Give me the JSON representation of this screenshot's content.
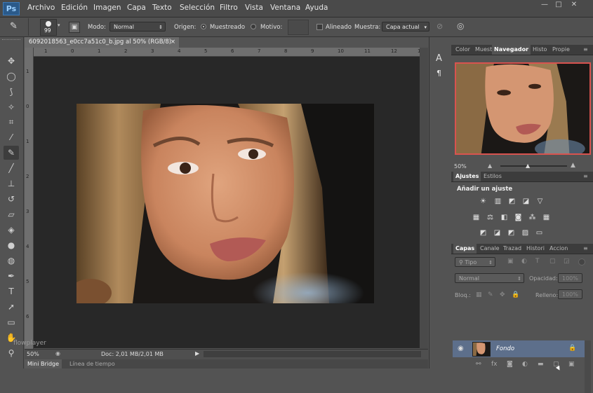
{
  "app": {
    "logo": "Ps"
  },
  "menu": [
    "Archivo",
    "Edición",
    "Imagen",
    "Capa",
    "Texto",
    "Selección",
    "Filtro",
    "Vista",
    "Ventana",
    "Ayuda"
  ],
  "window_controls": [
    "—",
    "□",
    "✕"
  ],
  "options": {
    "brush_size": "99",
    "modo_label": "Modo:",
    "modo_value": "Normal",
    "origen_label": "Origen:",
    "muestreado_label": "Muestreado",
    "motivo_label": "Motivo:",
    "alineado_label": "Alineado",
    "muestra_label": "Muestra:",
    "muestra_value": "Capa actual"
  },
  "document": {
    "tab_title": "6092018563_e0cc7a51c0_b.jpg al 50% (RGB/8)",
    "tab_close": "×",
    "ruler_h": [
      "1",
      "0",
      "1",
      "2",
      "3",
      "4",
      "5",
      "6",
      "7",
      "8",
      "9",
      "10",
      "11",
      "12",
      "13",
      "14"
    ],
    "ruler_v": [
      "1",
      "0",
      "1",
      "2",
      "3",
      "4",
      "5",
      "6"
    ],
    "zoom": "50%",
    "doc_info": "Doc: 2,01 MB/2,01 MB",
    "watermark": "flowplayer"
  },
  "bottom_tabs": [
    "Mini Bridge",
    "Línea de tiempo"
  ],
  "navigator": {
    "tabs": [
      "Color",
      "Muest",
      "Navegador",
      "Histo",
      "Propie"
    ],
    "zoom": "50%"
  },
  "adjustments": {
    "tabs": [
      "Ajustes",
      "Estilos"
    ],
    "title": "Añadir un ajuste"
  },
  "layers": {
    "tabs": [
      "Capas",
      "Canale",
      "Trazad",
      "Histori",
      "Accion"
    ],
    "filter": "Tipo",
    "blend_mode": "Normal",
    "opacity_label": "Opacidad:",
    "opacity_value": "100%",
    "lock_label": "Bloq.:",
    "fill_label": "Relleno:",
    "fill_value": "100%",
    "layer_name": "Fondo"
  },
  "colors": {
    "accent_red": "#d9534f",
    "layer_selected": "#5d6f8b"
  }
}
